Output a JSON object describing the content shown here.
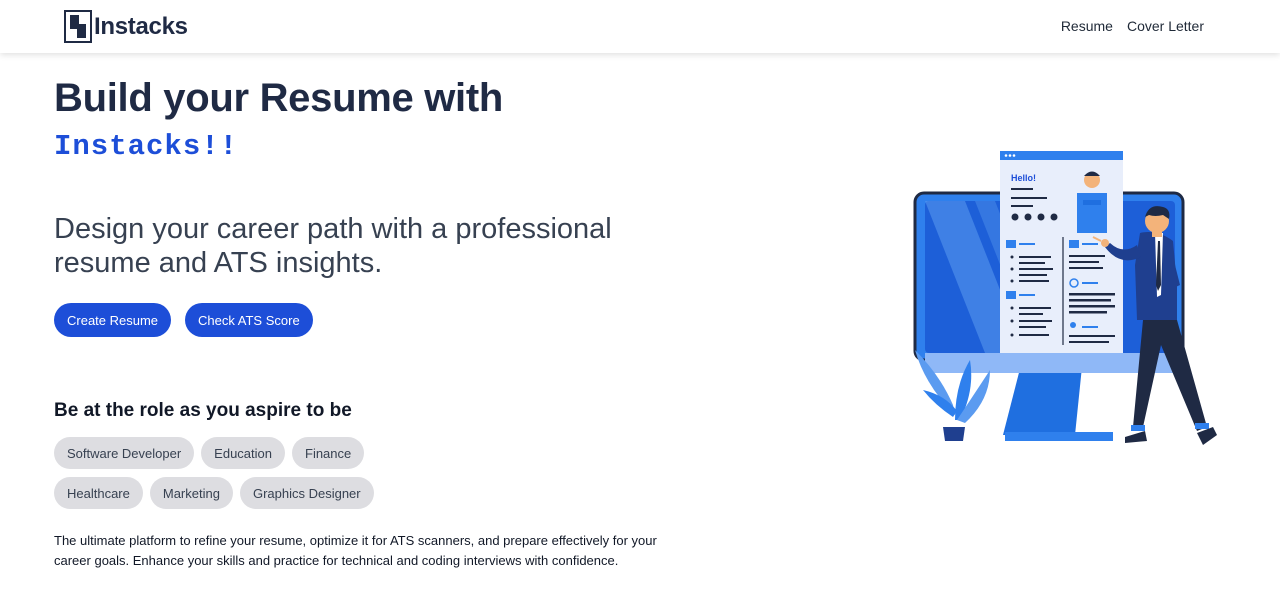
{
  "nav": {
    "brand": "Instacks",
    "links": [
      "Resume",
      "Cover Letter"
    ]
  },
  "hero": {
    "title": "Build your Resume with",
    "brand": "Instacks!!",
    "subtitle": "Design your career path with a professional resume and ATS insights.",
    "buttons": [
      "Create Resume",
      "Check ATS Score"
    ]
  },
  "roles": {
    "title": "Be at the role as you aspire to be",
    "chips": [
      "Software Developer",
      "Education",
      "Finance",
      "Healthcare",
      "Marketing",
      "Graphics Designer"
    ]
  },
  "about": {
    "text": "The ultimate platform to refine your resume, optimize it for ATS scanners, and prepare effectively for your career goals. Enhance your skills and practice for technical and coding interviews with confidence."
  },
  "illustration": {
    "resume_greeting": "Hello!"
  },
  "colors": {
    "accent": "#1d4ed8",
    "title": "#1f2a44",
    "chip_bg": "#dddde1",
    "illustration_blue": "#2f80ed"
  }
}
